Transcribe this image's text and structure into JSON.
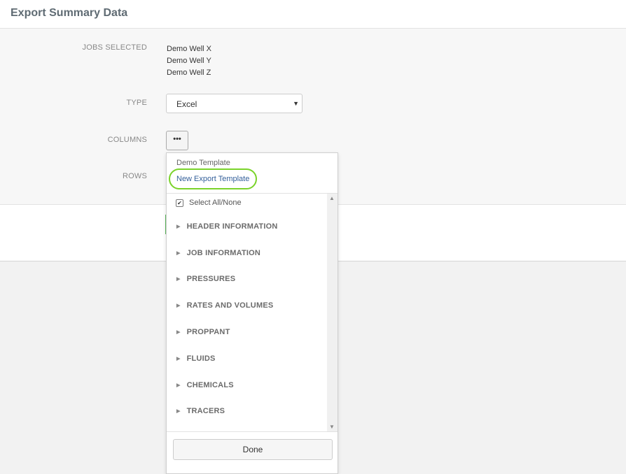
{
  "header": {
    "title": "Export Summary Data"
  },
  "form": {
    "jobs_label": "JOBS SELECTED",
    "jobs": [
      "Demo Well X",
      "Demo Well Y",
      "Demo Well Z"
    ],
    "type_label": "TYPE",
    "type_value": "Excel",
    "columns_label": "COLUMNS",
    "columns_button": "•••",
    "rows_label": "ROWS"
  },
  "dropdown": {
    "templates": [
      "Demo Template",
      "New Export Template"
    ],
    "select_all": "Select All/None",
    "select_all_checked": true,
    "groups": [
      "HEADER INFORMATION",
      "JOB INFORMATION",
      "PRESSURES",
      "RATES AND VOLUMES",
      "PROPPANT",
      "FLUIDS",
      "CHEMICALS",
      "TRACERS"
    ],
    "done_label": "Done"
  },
  "colors": {
    "highlight": "#7ad32a",
    "link": "#34609a",
    "accent_stub": "#5cb85c"
  }
}
